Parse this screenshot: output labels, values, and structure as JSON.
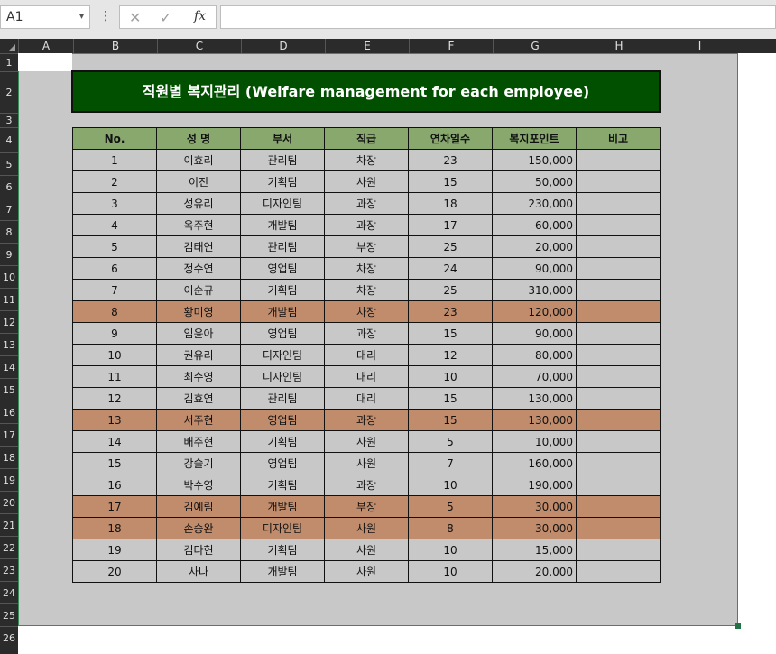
{
  "namebox": {
    "value": "A1",
    "caret": "▾"
  },
  "formula_bar": {
    "menu_glyph": "⋮",
    "cancel_glyph": "✕",
    "enter_glyph": "✓",
    "fx_label": "fx",
    "value": ""
  },
  "columns": [
    "A",
    "B",
    "C",
    "D",
    "E",
    "F",
    "G",
    "H",
    "I"
  ],
  "rows": [
    "1",
    "2",
    "3",
    "4",
    "5",
    "6",
    "7",
    "8",
    "9",
    "10",
    "11",
    "12",
    "13",
    "14",
    "15",
    "16",
    "17",
    "18",
    "19",
    "20",
    "21",
    "22",
    "23",
    "24",
    "25",
    "26"
  ],
  "title": "직원별 복지관리 (Welfare management for each employee)",
  "table": {
    "headers": [
      "No.",
      "성 명",
      "부서",
      "직급",
      "연차일수",
      "복지포인트",
      "비고"
    ],
    "rows": [
      {
        "no": "1",
        "name": "이효리",
        "dept": "관리팀",
        "rank": "차장",
        "days": "23",
        "points": "150,000",
        "note": "",
        "highlight": false
      },
      {
        "no": "2",
        "name": "이진",
        "dept": "기획팀",
        "rank": "사원",
        "days": "15",
        "points": "50,000",
        "note": "",
        "highlight": false
      },
      {
        "no": "3",
        "name": "성유리",
        "dept": "디자인팀",
        "rank": "과장",
        "days": "18",
        "points": "230,000",
        "note": "",
        "highlight": false
      },
      {
        "no": "4",
        "name": "옥주현",
        "dept": "개발팀",
        "rank": "과장",
        "days": "17",
        "points": "60,000",
        "note": "",
        "highlight": false
      },
      {
        "no": "5",
        "name": "김태연",
        "dept": "관리팀",
        "rank": "부장",
        "days": "25",
        "points": "20,000",
        "note": "",
        "highlight": false
      },
      {
        "no": "6",
        "name": "정수연",
        "dept": "영업팀",
        "rank": "차장",
        "days": "24",
        "points": "90,000",
        "note": "",
        "highlight": false
      },
      {
        "no": "7",
        "name": "이순규",
        "dept": "기획팀",
        "rank": "차장",
        "days": "25",
        "points": "310,000",
        "note": "",
        "highlight": false
      },
      {
        "no": "8",
        "name": "황미영",
        "dept": "개발팀",
        "rank": "차장",
        "days": "23",
        "points": "120,000",
        "note": "",
        "highlight": true
      },
      {
        "no": "9",
        "name": "임윤아",
        "dept": "영업팀",
        "rank": "과장",
        "days": "15",
        "points": "90,000",
        "note": "",
        "highlight": false
      },
      {
        "no": "10",
        "name": "권유리",
        "dept": "디자인팀",
        "rank": "대리",
        "days": "12",
        "points": "80,000",
        "note": "",
        "highlight": false
      },
      {
        "no": "11",
        "name": "최수영",
        "dept": "디자인팀",
        "rank": "대리",
        "days": "10",
        "points": "70,000",
        "note": "",
        "highlight": false
      },
      {
        "no": "12",
        "name": "김효연",
        "dept": "관리팀",
        "rank": "대리",
        "days": "15",
        "points": "130,000",
        "note": "",
        "highlight": false
      },
      {
        "no": "13",
        "name": "서주현",
        "dept": "영업팀",
        "rank": "과장",
        "days": "15",
        "points": "130,000",
        "note": "",
        "highlight": true
      },
      {
        "no": "14",
        "name": "배주현",
        "dept": "기획팀",
        "rank": "사원",
        "days": "5",
        "points": "10,000",
        "note": "",
        "highlight": false
      },
      {
        "no": "15",
        "name": "강슬기",
        "dept": "영업팀",
        "rank": "사원",
        "days": "7",
        "points": "160,000",
        "note": "",
        "highlight": false
      },
      {
        "no": "16",
        "name": "박수영",
        "dept": "기획팀",
        "rank": "과장",
        "days": "10",
        "points": "190,000",
        "note": "",
        "highlight": false
      },
      {
        "no": "17",
        "name": "김예림",
        "dept": "개발팀",
        "rank": "부장",
        "days": "5",
        "points": "30,000",
        "note": "",
        "highlight": true
      },
      {
        "no": "18",
        "name": "손승완",
        "dept": "디자인팀",
        "rank": "사원",
        "days": "8",
        "points": "30,000",
        "note": "",
        "highlight": true
      },
      {
        "no": "19",
        "name": "김다현",
        "dept": "기획팀",
        "rank": "사원",
        "days": "10",
        "points": "15,000",
        "note": "",
        "highlight": false
      },
      {
        "no": "20",
        "name": "사나",
        "dept": "개발팀",
        "rank": "사원",
        "days": "10",
        "points": "20,000",
        "note": "",
        "highlight": false
      }
    ]
  },
  "colors": {
    "title_bg": "#005000",
    "header_bg": "#88a86e",
    "highlight_bg": "#c08c6c",
    "area_bg": "#c8c8c8",
    "selection": "#217346"
  }
}
